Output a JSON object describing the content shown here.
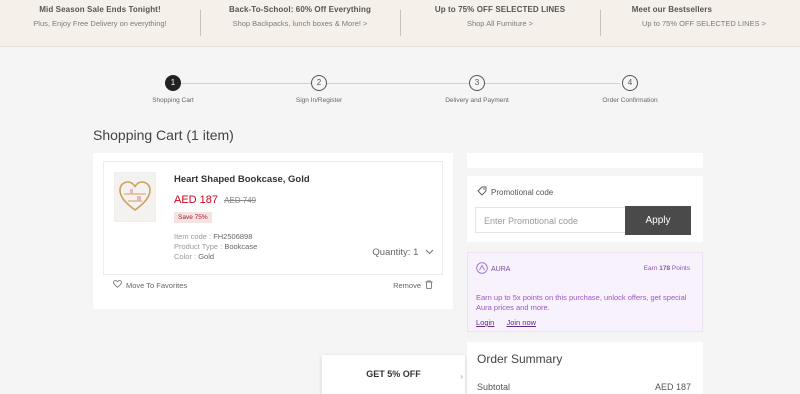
{
  "promos": [
    {
      "title": "Mid Season Sale Ends Tonight!",
      "sub": "Plus, Enjoy Free Delivery on everything!"
    },
    {
      "title": "Back-To-School: 60% Off Everything",
      "sub": "Shop Backpacks, lunch boxes & More! >"
    },
    {
      "title": "Up to 75% OFF SELECTED LINES",
      "sub": "Shop All Furniture >"
    },
    {
      "title": "Meet our Bestsellers",
      "sub": "Up to 75% OFF SELECTED LINES >"
    }
  ],
  "steps": [
    {
      "num": "1",
      "label": "Shopping Cart"
    },
    {
      "num": "2",
      "label": "Sign In/Register"
    },
    {
      "num": "3",
      "label": "Delivery and Payment"
    },
    {
      "num": "4",
      "label": "Order Confirmation"
    }
  ],
  "cart": {
    "heading": "Shopping Cart (1 item)",
    "item": {
      "name": "Heart Shaped Bookcase, Gold",
      "price": "AED 187",
      "old_price": "AED 749",
      "save": "Save 75%",
      "code_label": "Item code : ",
      "code": "FH2506898",
      "type_label": "Product Type : ",
      "type": "Bookcase",
      "color_label": "Color : ",
      "color": "Gold",
      "quantity": "Quantity: 1"
    },
    "move_to_favorites": "Move To Favorites",
    "remove": "Remove"
  },
  "promo_code": {
    "label": "Promotional code",
    "placeholder": "Enter Promotional code",
    "apply": "Apply"
  },
  "aura": {
    "brand": "AURA",
    "points_prefix": "Earn",
    "points_value": "178",
    "points_suffix": "Points",
    "text": "Earn up to 5x points on this purchase, unlock offers, get special Aura prices and more.",
    "login": "Login",
    "join": "Join now"
  },
  "summary": {
    "title": "Order Summary",
    "subtotal_label": "Subtotal",
    "subtotal_value": "AED 187"
  },
  "floating_banner": {
    "text": "GET 5% OFF"
  },
  "colors": {
    "price_red": "#d0021b",
    "aura_purple": "#7c4aa5",
    "apply_button": "#4a4a4a",
    "promo_bar": "#f5f1ea"
  }
}
